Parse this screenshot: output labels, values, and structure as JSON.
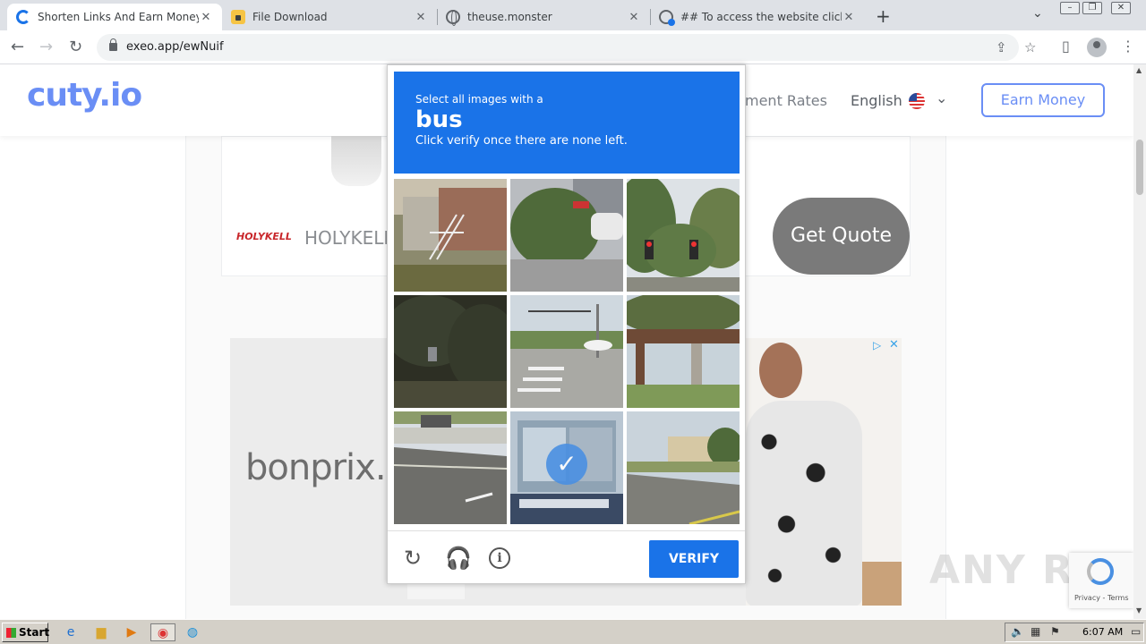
{
  "browser": {
    "tabs": [
      {
        "title": "Shorten Links And Earn Money | cuty",
        "icon": "cuty-favicon",
        "active": true
      },
      {
        "title": "File Download",
        "icon": "lock-favicon",
        "active": false
      },
      {
        "title": "theuse.monster",
        "icon": "globe-icon",
        "active": false
      },
      {
        "title": "## To access the website click the \"/",
        "icon": "globe-icon",
        "active": false
      }
    ],
    "new_tab": "+",
    "url": "exeo.app/ewNuif"
  },
  "site": {
    "logo": "cuty.io",
    "nav_rates": "ment Rates",
    "language": "English",
    "earn_button": "Earn Money"
  },
  "ad1": {
    "brand_logo": "HOLYKELL",
    "brand_text": "HOLYKELL",
    "cta": "Get Quote"
  },
  "ad2": {
    "brand": "bonprix."
  },
  "captcha": {
    "instruction": "Select all images with a",
    "target": "bus",
    "hint": "Click verify once there are none left.",
    "verify_label": "VERIFY",
    "tiles": [
      {
        "scene": "house-porch",
        "selected": false
      },
      {
        "scene": "street-tree",
        "selected": false
      },
      {
        "scene": "traffic-light",
        "selected": false
      },
      {
        "scene": "dark-trees",
        "selected": false
      },
      {
        "scene": "crosswalk",
        "selected": false
      },
      {
        "scene": "shelter",
        "selected": false
      },
      {
        "scene": "road-truck",
        "selected": false
      },
      {
        "scene": "bus-window",
        "selected": true
      },
      {
        "scene": "road-building",
        "selected": false
      }
    ]
  },
  "recaptcha_badge": {
    "text": "Privacy - Terms"
  },
  "watermark": "ANY RUN",
  "taskbar": {
    "start_label": "Start",
    "clock": "6:07 AM"
  }
}
